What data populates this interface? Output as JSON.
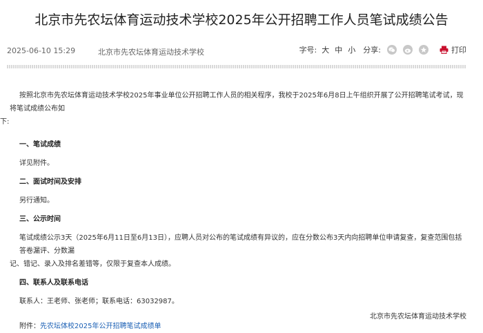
{
  "article": {
    "title": "北京市先农坛体育运动技术学校2025年公开招聘工作人员笔试成绩公告",
    "date": "2025-06-10 15:29",
    "source": "北京市先农坛体育运动技术学校",
    "font_size_label": "字号:",
    "font_sizes": [
      "大",
      "中",
      "小"
    ],
    "share_label": "分享:",
    "share_icons": [
      "wechat-icon",
      "weibo-icon",
      "qzone-icon"
    ],
    "print_label": "打印",
    "print_color": "#c8102e",
    "intro_line1": "按照北京市先农坛体育运动技术学校2025年事业单位公开招聘工作人员的相关程序，我校于2025年6月8日上午组织开展了公开招聘笔试考试，现将笔试成绩公布如",
    "intro_line2": "下:",
    "sections": [
      {
        "heading": "一、笔试成绩",
        "lines": [
          "详见附件。"
        ]
      },
      {
        "heading": "二、面试时间及安排",
        "lines": [
          "另行通知。"
        ]
      },
      {
        "heading": "三、公示时间",
        "lines": [
          "笔试成绩公示3天（2025年6月11日至6月13日），应聘人员对公布的笔试成绩有异议的，应在分数公布3天内向招聘单位申请复查，复查范围包括答卷漏评、分数漏",
          "记、错记、录入及排名差错等，仅限于复查本人成绩。"
        ]
      },
      {
        "heading": "四、联系人及联系电话",
        "lines": [
          "联系人：王老师、张老师；联系电话：63032987。"
        ]
      }
    ],
    "attachment_label": "附件：",
    "attachment_link": "先农坛体校2025年公开招聘笔试成绩单",
    "link_color": "#1a5fb4",
    "signature": "北京市先农坛体育运动技术学校"
  }
}
